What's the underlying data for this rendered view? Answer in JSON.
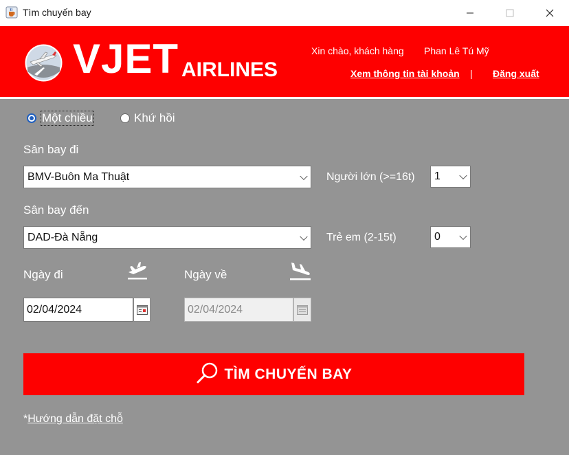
{
  "window": {
    "title": "Tìm chuyến bay"
  },
  "header": {
    "brand_main": "VJET",
    "brand_sub": "AIRLINES",
    "greeting": "Xin chào,  khách hàng",
    "username": "Phan Lê Tú Mỹ",
    "account_link": "Xem thông tin tài khoản",
    "separator": "|",
    "logout_link": "Đăng xuất",
    "color": "#fe0000"
  },
  "trip_type": {
    "one_way": "Một chiều",
    "round_trip": "Khứ hồi",
    "selected": "one_way"
  },
  "origin": {
    "label": "Sân bay đi",
    "value": "BMV-Buôn Ma Thuật"
  },
  "destination": {
    "label": "Sân bay đến",
    "value": "DAD-Đà Nẵng"
  },
  "adults": {
    "label": "Người lớn (>=16t)",
    "value": "1"
  },
  "children": {
    "label": "Trẻ em (2-15t)",
    "value": "0"
  },
  "depart": {
    "label": "Ngày đi",
    "value": "02/04/2024"
  },
  "return": {
    "label": "Ngày về",
    "value": "02/04/2024",
    "disabled": true
  },
  "search_button": {
    "label": "TÌM CHUYẾN BAY"
  },
  "guide": {
    "prefix": "*",
    "link": "Hướng dẫn đặt chỗ"
  },
  "icons": {
    "app": "java-cup-icon",
    "logo": "airplane-logo-icon",
    "takeoff": "takeoff-icon",
    "landing": "landing-icon",
    "calendar": "calendar-icon",
    "search": "search-icon"
  }
}
